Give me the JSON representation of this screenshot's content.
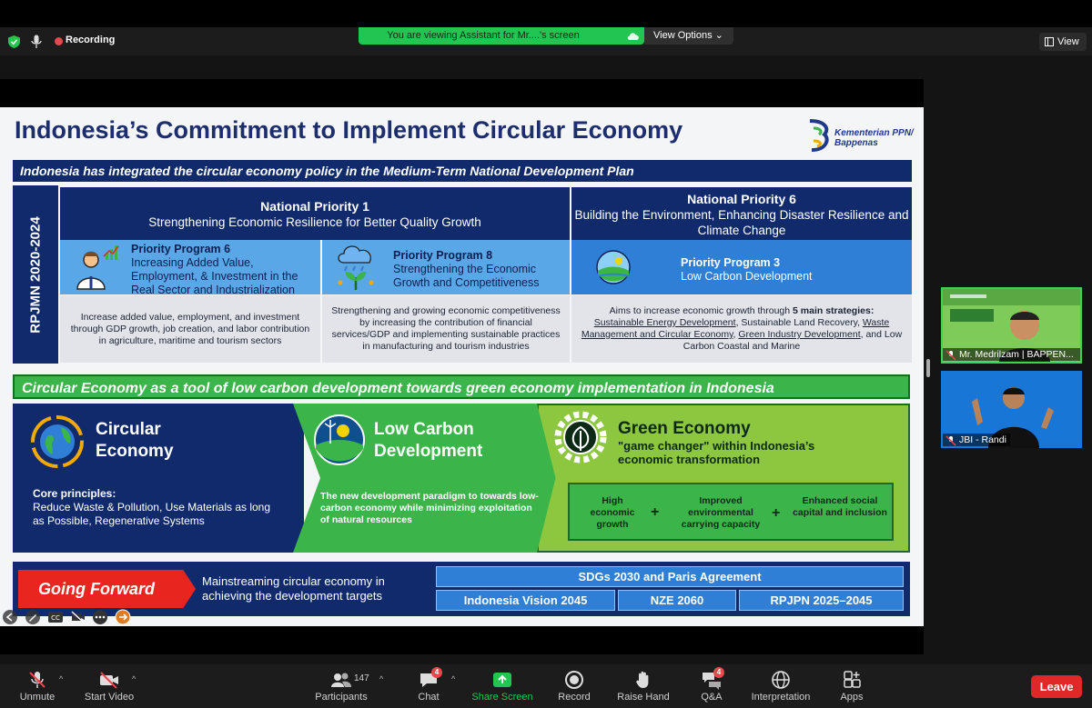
{
  "meeting": {
    "recording_label": "Recording",
    "viewing_banner": "You are viewing Assistant for Mr....'s screen",
    "view_options_label": "View Options",
    "view_button_label": "View"
  },
  "slide": {
    "title": "Indonesia’s Commitment to Implement Circular Economy",
    "logo_text_line1": "Kementerian PPN/",
    "logo_text_line2": "Bappenas",
    "band1": "Indonesia has integrated the circular economy policy in the Medium-Term National Development Plan",
    "rpjmn_label": "RPJMN 2020-2024",
    "np1_title": "National Priority 1",
    "np1_subtitle": "Strengthening Economic Resilience for Better Quality Growth",
    "np6_title": "National Priority 6",
    "np6_subtitle": "Building the Environment, Enhancing Disaster Resilience and Climate Change",
    "programs": [
      {
        "title": "Priority Program 6",
        "text": "Increasing Added Value, Employment, & Investment in the Real Sector and Industrialization",
        "desc": "Increase added value, employment, and investment through GDP growth, job creation, and labor contribution in agriculture, maritime and tourism sectors"
      },
      {
        "title": "Priority Program 8",
        "text": "Strengthening the Economic Growth and Competitiveness",
        "desc": "Strengthening and growing economic competitiveness by increasing the contribution of financial services/GDP and implementing sustainable practices in manufacturing and tourism industries"
      },
      {
        "title": "Priority Program 3",
        "text": "Low Carbon Development",
        "desc_intro": "Aims to increase economic growth through",
        "desc_bold": "5 main strategies:",
        "strategies": [
          "Sustainable Energy Development",
          "Sustainable Land Recovery",
          "Waste Management and Circular Economy",
          "Green Industry Development",
          "Low Carbon Coastal and Marine"
        ]
      }
    ],
    "band2": "Circular Economy as a tool of low carbon development towards green economy implementation in Indonesia",
    "ce_title_line1": "Circular",
    "ce_title_line2": "Economy",
    "ce_core_label": "Core principles:",
    "ce_core_text": "Reduce Waste & Pollution, Use Materials as long as Possible, Regenerative Systems",
    "lcd_title_line1": "Low Carbon",
    "lcd_title_line2": "Development",
    "lcd_desc": "The new development paradigm to towards low-carbon economy while minimizing exploitation of natural resources",
    "ge_title": "Green Economy",
    "ge_sub": "\"game changer\" within Indonesia’s economic transformation",
    "ge_items": [
      "High economic growth",
      "Improved environmental carrying capacity",
      "Enhanced social capital and inclusion"
    ],
    "plus": "+",
    "gf_label": "Going Forward",
    "gf_text": "Mainstreaming circular economy in achieving the development targets",
    "sdg_label": "SDGs 2030 and Paris Agreement",
    "goals": [
      "Indonesia Vision 2045",
      "NZE 2060",
      "RPJPN 2025–2045"
    ]
  },
  "participants": [
    {
      "name": "Mr. Medrilzam | BAPPEN..."
    },
    {
      "name": "JBI - Randi"
    }
  ],
  "toolbar": {
    "unmute": "Unmute",
    "start_video": "Start Video",
    "participants": "Participants",
    "participants_count": "147",
    "chat": "Chat",
    "chat_badge": "4",
    "share_screen": "Share Screen",
    "record": "Record",
    "raise_hand": "Raise Hand",
    "qa": "Q&A",
    "qa_badge": "4",
    "interpretation": "Interpretation",
    "apps": "Apps",
    "leave": "Leave"
  },
  "colors": {
    "navy": "#102a6b",
    "green": "#3bb54a",
    "lime": "#8dc63f",
    "blue": "#2f7fd6",
    "red": "#e8251f",
    "share_green": "#23c552"
  }
}
